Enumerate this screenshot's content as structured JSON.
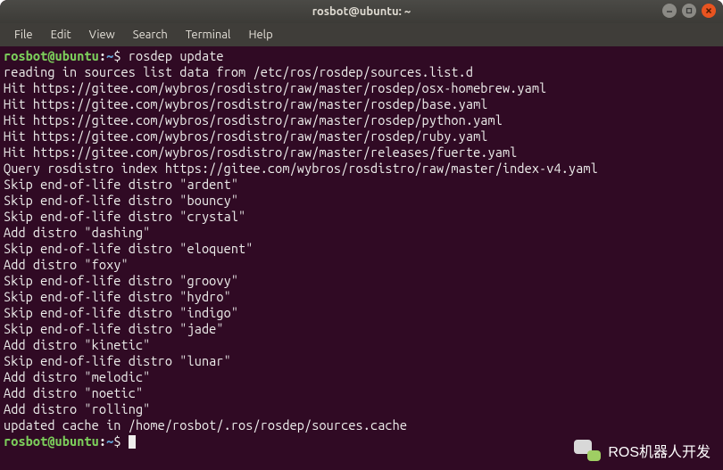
{
  "title": "rosbot@ubuntu: ~",
  "menu": [
    "File",
    "Edit",
    "View",
    "Search",
    "Terminal",
    "Help"
  ],
  "prompt": {
    "user": "rosbot@ubuntu",
    "colon": ":",
    "path": "~",
    "dollar": "$"
  },
  "command": "rosdep update",
  "output_lines": [
    "reading in sources list data from /etc/ros/rosdep/sources.list.d",
    "Hit https://gitee.com/wybros/rosdistro/raw/master/rosdep/osx-homebrew.yaml",
    "Hit https://gitee.com/wybros/rosdistro/raw/master/rosdep/base.yaml",
    "Hit https://gitee.com/wybros/rosdistro/raw/master/rosdep/python.yaml",
    "Hit https://gitee.com/wybros/rosdistro/raw/master/rosdep/ruby.yaml",
    "Hit https://gitee.com/wybros/rosdistro/raw/master/releases/fuerte.yaml",
    "Query rosdistro index https://gitee.com/wybros/rosdistro/raw/master/index-v4.yaml",
    "Skip end-of-life distro \"ardent\"",
    "Skip end-of-life distro \"bouncy\"",
    "Skip end-of-life distro \"crystal\"",
    "Add distro \"dashing\"",
    "Skip end-of-life distro \"eloquent\"",
    "Add distro \"foxy\"",
    "Skip end-of-life distro \"groovy\"",
    "Skip end-of-life distro \"hydro\"",
    "Skip end-of-life distro \"indigo\"",
    "Skip end-of-life distro \"jade\"",
    "Add distro \"kinetic\"",
    "Skip end-of-life distro \"lunar\"",
    "Add distro \"melodic\"",
    "Add distro \"noetic\"",
    "Add distro \"rolling\"",
    "updated cache in /home/rosbot/.ros/rosdep/sources.cache"
  ],
  "watermark_text": "ROS机器人开发"
}
